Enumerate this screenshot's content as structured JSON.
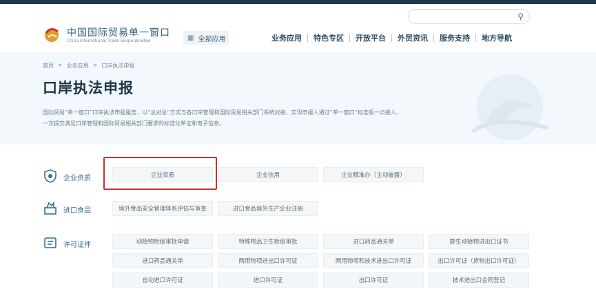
{
  "header": {
    "search_placeholder": "",
    "brand_cn": "中国国际贸易单一窗口",
    "brand_en": "China International Trade Single Window",
    "all_apps": "全部应用",
    "nav": [
      "业务应用",
      "特色专区",
      "开放平台",
      "外贸资讯",
      "服务支持",
      "地方导航"
    ]
  },
  "banner": {
    "breadcrumb": [
      "首页",
      ">",
      "业务应用",
      ">",
      "口岸执法申报"
    ],
    "title": "口岸执法申报",
    "description_line1": "国际贸易“单一窗口”口岸执法申报服务，以“总对总”方式与各口岸管理和国际贸易相关部门系统对接，实现申报人通过“单一窗口”标准版一点接入、",
    "description_line2": "一次提交满足口岸管理和国际贸易相关部门要求的标准化单证和电子信息。"
  },
  "sections": [
    {
      "label": "企业资质",
      "items": [
        "企业资质",
        "企业信用",
        "企业精准办（主动披露）"
      ]
    },
    {
      "label": "进口食品",
      "items": [
        "境外食品安全管理体系评估与审查",
        "进口食品境外生产企业注册"
      ]
    },
    {
      "label": "许可证件",
      "items": [
        "动植物检疫审批申请",
        "特殊物品卫生检疫审批",
        "进口药品通关单",
        "野生动植物进出口证书",
        "进口药品通关单",
        "两用物项进出口许可证",
        "两用物项和技术进出口许可证",
        "出口许可证（货物出口许可证）",
        "自动进口许可证",
        "进口许可证",
        "出口许可证",
        "技术进出口合同登记"
      ]
    }
  ],
  "colors": {
    "accent": "#34708f",
    "highlight": "#c8332e",
    "topbar": "#1f3a4d"
  }
}
